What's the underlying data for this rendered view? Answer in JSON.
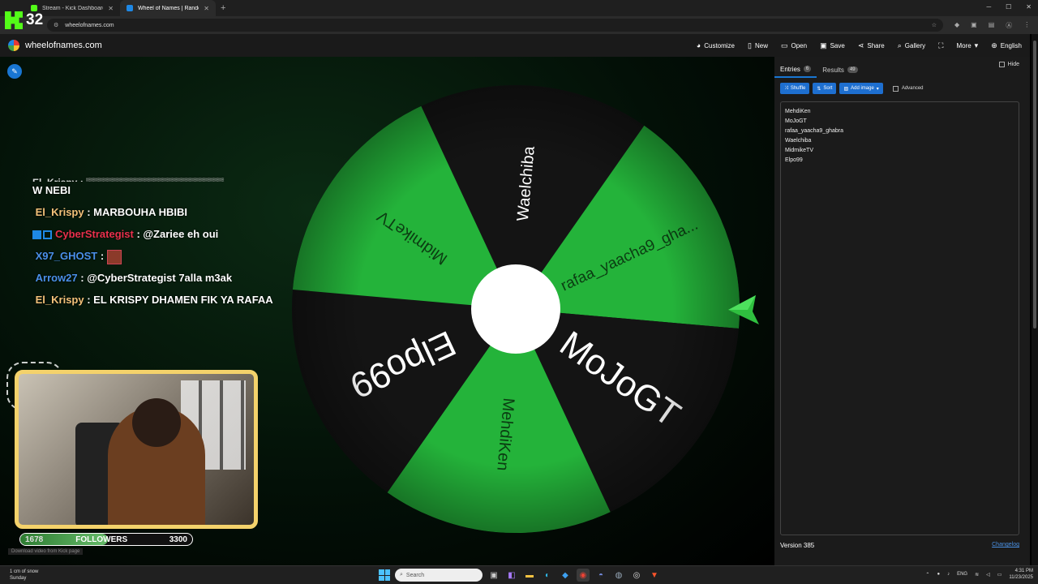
{
  "browser": {
    "tabs": [
      {
        "title": "Stream - Kick Dashboard",
        "fav_color": "#53fc18"
      },
      {
        "title": "Wheel of Names | Random nam",
        "fav_color": "#1e88e5"
      }
    ],
    "url": "wheelofnames.com"
  },
  "overlay": {
    "kick_count": "32"
  },
  "site": {
    "name": "wheelofnames.com",
    "menu": {
      "customize": "Customize",
      "new": "New",
      "open": "Open",
      "save": "Save",
      "share": "Share",
      "gallery": "Gallery",
      "more": "More",
      "language": "English"
    }
  },
  "chat": {
    "lines": [
      {
        "user": "",
        "text": "W NEBI",
        "color": "#fff"
      },
      {
        "user": "El_Krispy",
        "text": ": MARBOUHA HBIBI",
        "color": "#f4c27a"
      },
      {
        "user": "CyberStrategist",
        "text": ": @Zariee eh oui",
        "color": "#e8304c"
      },
      {
        "user": "X97_GHOST",
        "text": ":",
        "color": "#4a8fe8"
      },
      {
        "user": "Arrow27",
        "text": ": @CyberStrategist 7alla m3ak",
        "color": "#4a8fe8"
      },
      {
        "user": "El_Krispy",
        "text": ": EL KRISPY DHAMEN FIK YA RAFAA",
        "color": "#f4c27a"
      }
    ]
  },
  "followers": {
    "current": "1678",
    "label": "FOLLOWERS",
    "goal": "3300",
    "progress": 0.51
  },
  "download_hint": "Download video from Kick page",
  "wheel": {
    "colors": {
      "green": "#24b33a",
      "dark": "#141414"
    },
    "segments": [
      "Waelchiba",
      "rafaa_yaacha9_gha...",
      "MoJoGT",
      "MehdiKen",
      "Elpo99",
      "MidmikeTV"
    ]
  },
  "panel": {
    "tab_entries": "Entries",
    "entries_count": "6",
    "tab_results": "Results",
    "results_count": "49",
    "hide": "Hide",
    "shuffle": "Shuffle",
    "sort": "Sort",
    "add_image": "Add image",
    "advanced": "Advanced",
    "entries": [
      "MehdiKen",
      "MoJoGT",
      "rafaa_yaacha9_ghabra",
      "Waelchiba",
      "MidmikeTV",
      "Elpo99"
    ],
    "version": "Version 385",
    "changelog": "Changelog"
  },
  "taskbar": {
    "weather_line1": "1 cm of snow",
    "weather_line2": "Sunday",
    "search": "Search",
    "lang": "ENG",
    "time": "4:31 PM",
    "date": "11/23/2025"
  }
}
